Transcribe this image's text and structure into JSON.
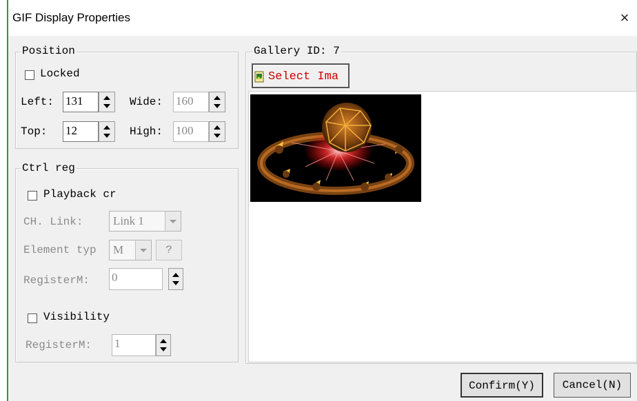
{
  "window": {
    "title": "GIF Display Properties",
    "close_glyph": "×"
  },
  "position": {
    "legend": "Position",
    "locked_label": "Locked",
    "locked_checked": false,
    "left_label": "Left:",
    "left_value": "131",
    "top_label": "Top:",
    "top_value": "12",
    "wide_label": "Wide:",
    "wide_value": "160",
    "high_label": "High:",
    "high_value": "100"
  },
  "ctrl_reg": {
    "legend": "Ctrl reg",
    "playback_label": "Playback cr",
    "playback_checked": false,
    "ch_link_label": "CH. Link:",
    "ch_link_value": "Link 1",
    "element_type_label": "Element typ",
    "element_type_value": "M",
    "help_button": "?",
    "register_m_label": "RegisterM:",
    "register_m_value": "0",
    "visibility_label": "Visibility",
    "visibility_checked": false,
    "register_m2_label": "RegisterM:",
    "register_m2_value": "1"
  },
  "gallery": {
    "legend": "Gallery ID: 7",
    "select_image_label": "Select Ima",
    "select_icon": "image-file-icon",
    "preview_icon": "gif-preview-image"
  },
  "footer": {
    "confirm_label": "Confirm(Y)",
    "cancel_label": "Cancel(N)"
  },
  "colors": {
    "select_text": "#cc0000",
    "window_bg": "#f0f0f0",
    "accent_line": "#22a033"
  }
}
